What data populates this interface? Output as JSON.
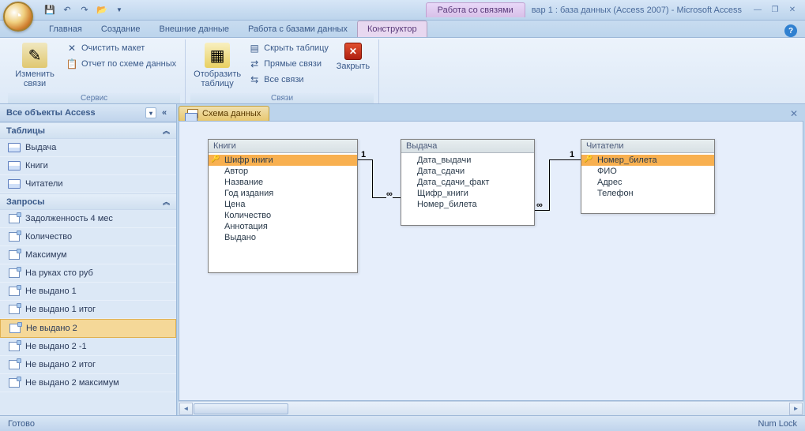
{
  "titlebar": {
    "context_tab": "Работа со связями",
    "app_title": "вар 1 : база данных (Access 2007) - Microsoft Access"
  },
  "tabs": {
    "home": "Главная",
    "create": "Создание",
    "external": "Внешние данные",
    "dbtools": "Работа с базами данных",
    "design": "Конструктор"
  },
  "ribbon": {
    "group_service": "Сервис",
    "group_relations": "Связи",
    "edit_relations": "Изменить связи",
    "clear_layout": "Очистить макет",
    "schema_report": "Отчет по схеме данных",
    "show_table": "Отобразить таблицу",
    "hide_table": "Скрыть таблицу",
    "direct_relations": "Прямые связи",
    "all_relations": "Все связи",
    "close": "Закрыть"
  },
  "nav": {
    "header": "Все объекты Access",
    "section_tables": "Таблицы",
    "section_queries": "Запросы",
    "tables": [
      {
        "label": "Выдача"
      },
      {
        "label": "Книги"
      },
      {
        "label": "Читатели"
      }
    ],
    "queries": [
      {
        "label": "Задолженность 4 мес"
      },
      {
        "label": "Количество"
      },
      {
        "label": "Максимум"
      },
      {
        "label": "На руках сто руб"
      },
      {
        "label": "Не выдано 1"
      },
      {
        "label": "Не выдано 1 итог"
      },
      {
        "label": "Не выдано 2"
      },
      {
        "label": "Не выдано 2 -1"
      },
      {
        "label": "Не выдано 2 итог"
      },
      {
        "label": "Не выдано 2 максимум"
      }
    ]
  },
  "doc_tab": "Схема данных",
  "diagram": {
    "tables": {
      "books": {
        "title": "Книги",
        "fields": [
          "Шифр книги",
          "Автор",
          "Название",
          "Год издания",
          "Цена",
          "Количество",
          "Аннотация",
          "Выдано"
        ],
        "pk_index": 0
      },
      "issue": {
        "title": "Выдача",
        "fields": [
          "Дата_выдачи",
          "Дата_сдачи",
          "Дата_сдачи_факт",
          "Щифр_книги",
          "Номер_билета"
        ],
        "pk_index": -1
      },
      "readers": {
        "title": "Читатели",
        "fields": [
          "Номер_билета",
          "ФИО",
          "Адрес",
          "Телефон"
        ],
        "pk_index": 0
      }
    },
    "rel_labels": {
      "one1": "1",
      "inf1": "∞",
      "one2": "1",
      "inf2": "∞"
    }
  },
  "statusbar": {
    "ready": "Готово",
    "numlock": "Num Lock"
  }
}
